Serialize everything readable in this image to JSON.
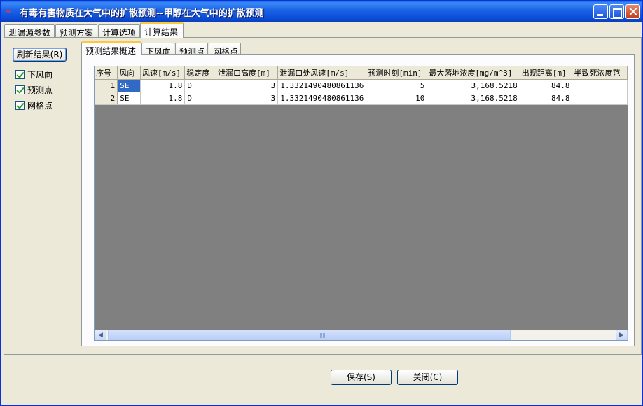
{
  "window": {
    "title": "有毒有害物质在大气中的扩散预测--甲醇在大气中的扩散预测"
  },
  "tabs": [
    {
      "label": "泄漏源参数"
    },
    {
      "label": "预测方案"
    },
    {
      "label": "计算选项"
    },
    {
      "label": "计算结果"
    }
  ],
  "sidebar": {
    "refresh_label": "刷新结果(R)",
    "checks": [
      {
        "label": "下风向",
        "checked": true
      },
      {
        "label": "预测点",
        "checked": true
      },
      {
        "label": "网格点",
        "checked": true
      }
    ]
  },
  "subtabs": [
    {
      "label": "预测结果概述"
    },
    {
      "label": "下风向"
    },
    {
      "label": "预测点"
    },
    {
      "label": "网格点"
    }
  ],
  "grid": {
    "columns": [
      "序号",
      "风向",
      "风速[m/s]",
      "稳定度",
      "泄漏口高度[m]",
      "泄漏口处风速[m/s]",
      "预测时刻[min]",
      "最大落地浓度[mg/m^3]",
      "出现距离[m]",
      "半致死浓度范"
    ],
    "rows": [
      [
        "1",
        "SE",
        "1.8",
        "D",
        "3",
        "1.3321490480861136",
        "5",
        "3,168.5218",
        "84.8",
        ""
      ],
      [
        "2",
        "SE",
        "1.8",
        "D",
        "3",
        "1.3321490480861136",
        "10",
        "3,168.5218",
        "84.8",
        ""
      ]
    ]
  },
  "footer": {
    "save_label": "保存(S)",
    "close_label": "关闭(C)"
  }
}
